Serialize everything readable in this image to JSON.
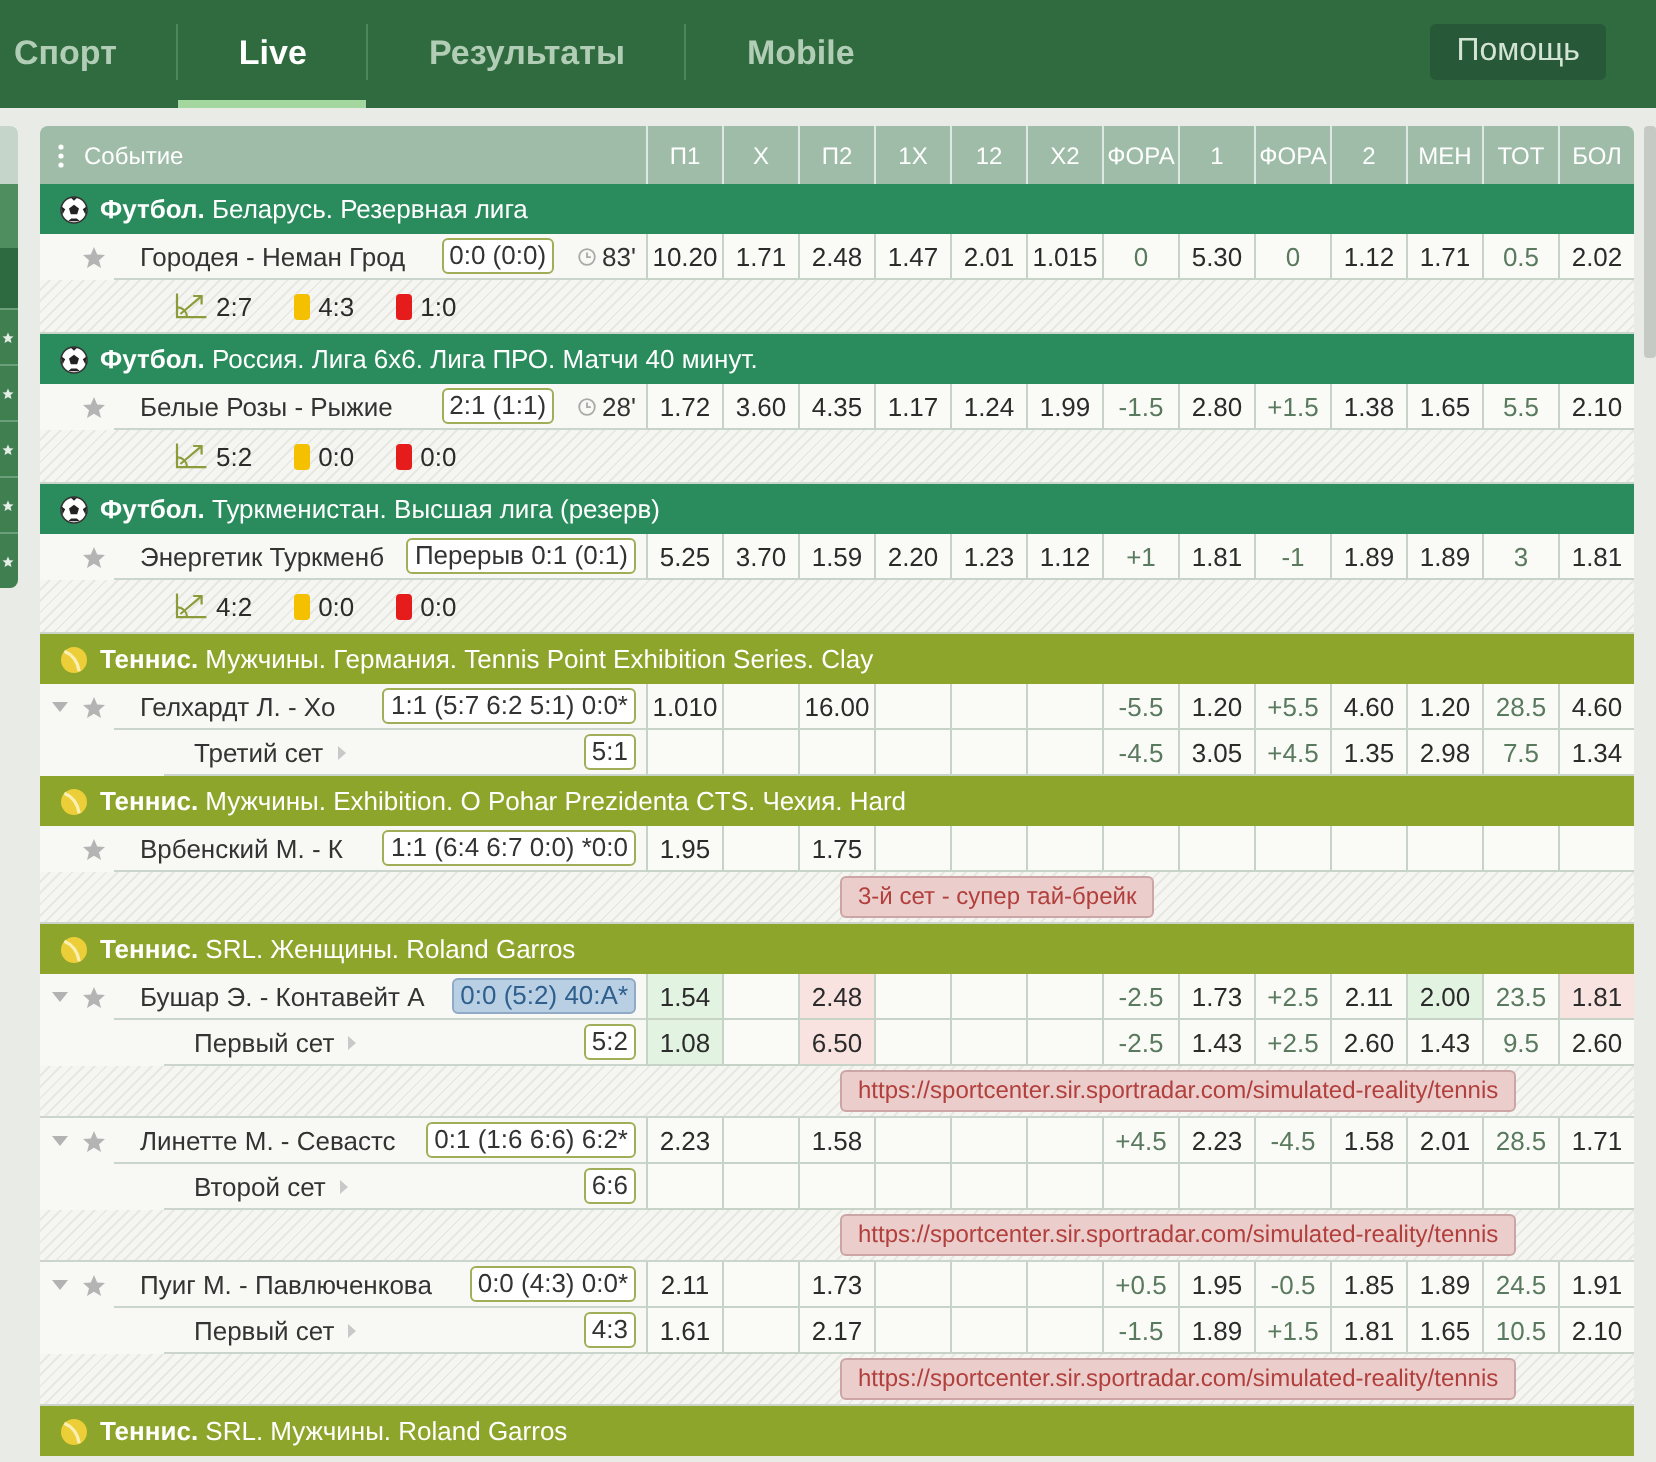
{
  "nav": {
    "tabs": [
      {
        "label": "Спорт",
        "selected": false
      },
      {
        "label": "Live",
        "selected": true
      },
      {
        "label": "Результаты",
        "selected": false
      },
      {
        "label": "Mobile",
        "selected": false
      }
    ],
    "help_button": "Помощь"
  },
  "table": {
    "event_header": "Событие",
    "columns": [
      {
        "label": "П1",
        "kind": "odds"
      },
      {
        "label": "X",
        "kind": "odds"
      },
      {
        "label": "П2",
        "kind": "odds"
      },
      {
        "label": "1X",
        "kind": "odds"
      },
      {
        "label": "12",
        "kind": "odds"
      },
      {
        "label": "X2",
        "kind": "odds"
      },
      {
        "label": "ФОРА",
        "kind": "line"
      },
      {
        "label": "1",
        "kind": "odds"
      },
      {
        "label": "ФОРА",
        "kind": "line"
      },
      {
        "label": "2",
        "kind": "odds"
      },
      {
        "label": "МЕН",
        "kind": "odds"
      },
      {
        "label": "ТОТ",
        "kind": "line"
      },
      {
        "label": "БОЛ",
        "kind": "odds"
      }
    ],
    "leagues": [
      {
        "kind": "football",
        "title": "**Футбол.** Беларусь. Резервная лига",
        "matches": [
          {
            "teams": "Городея - Неман Грод",
            "expandable": false,
            "favorite": false,
            "score": "0:0 (0:0)",
            "score_updated": false,
            "time": "83'",
            "odds": [
              {
                "kind": "plain",
                "value": "10.20"
              },
              {
                "kind": "plain",
                "value": "1.71"
              },
              {
                "kind": "plain",
                "value": "2.48"
              },
              {
                "kind": "plain",
                "value": "1.47"
              },
              {
                "kind": "plain",
                "value": "2.01"
              },
              {
                "kind": "plain",
                "value": "1.015"
              },
              {
                "kind": "plain",
                "value": "0"
              },
              {
                "kind": "plain",
                "value": "5.30"
              },
              {
                "kind": "plain",
                "value": "0"
              },
              {
                "kind": "plain",
                "value": "1.12"
              },
              {
                "kind": "plain",
                "value": "1.71"
              },
              {
                "kind": "plain",
                "value": "0.5"
              },
              {
                "kind": "plain",
                "value": "2.02"
              }
            ],
            "stats": [
              {
                "kind": "corners",
                "value": "2:7"
              },
              {
                "kind": "yellow_cards",
                "value": "4:3"
              },
              {
                "kind": "red_cards",
                "value": "1:0"
              }
            ]
          }
        ]
      },
      {
        "kind": "football",
        "title": "**Футбол.** Россия. Лига 6х6. Лига ПРО. Матчи 40 минут.",
        "matches": [
          {
            "teams": "Белые Розы - Рыжие",
            "expandable": false,
            "favorite": false,
            "score": "2:1 (1:1)",
            "score_updated": false,
            "time": "28'",
            "odds": [
              {
                "kind": "plain",
                "value": "1.72"
              },
              {
                "kind": "plain",
                "value": "3.60"
              },
              {
                "kind": "plain",
                "value": "4.35"
              },
              {
                "kind": "plain",
                "value": "1.17"
              },
              {
                "kind": "plain",
                "value": "1.24"
              },
              {
                "kind": "plain",
                "value": "1.99"
              },
              {
                "kind": "plain",
                "value": "-1.5"
              },
              {
                "kind": "plain",
                "value": "2.80"
              },
              {
                "kind": "plain",
                "value": "+1.5"
              },
              {
                "kind": "plain",
                "value": "1.38"
              },
              {
                "kind": "plain",
                "value": "1.65"
              },
              {
                "kind": "plain",
                "value": "5.5"
              },
              {
                "kind": "plain",
                "value": "2.10"
              }
            ],
            "stats": [
              {
                "kind": "corners",
                "value": "5:2"
              },
              {
                "kind": "yellow_cards",
                "value": "0:0"
              },
              {
                "kind": "red_cards",
                "value": "0:0"
              }
            ]
          }
        ]
      },
      {
        "kind": "football",
        "title": "**Футбол.** Туркменистан. Высшая лига (резерв)",
        "matches": [
          {
            "teams": "Энергетик Туркменб",
            "expandable": false,
            "favorite": false,
            "score": "Перерыв 0:1 (0:1)",
            "score_updated": false,
            "odds": [
              {
                "kind": "plain",
                "value": "5.25"
              },
              {
                "kind": "plain",
                "value": "3.70"
              },
              {
                "kind": "plain",
                "value": "1.59"
              },
              {
                "kind": "plain",
                "value": "2.20"
              },
              {
                "kind": "plain",
                "value": "1.23"
              },
              {
                "kind": "plain",
                "value": "1.12"
              },
              {
                "kind": "plain",
                "value": "+1"
              },
              {
                "kind": "plain",
                "value": "1.81"
              },
              {
                "kind": "plain",
                "value": "-1"
              },
              {
                "kind": "plain",
                "value": "1.89"
              },
              {
                "kind": "plain",
                "value": "1.89"
              },
              {
                "kind": "plain",
                "value": "3"
              },
              {
                "kind": "plain",
                "value": "1.81"
              }
            ],
            "stats": [
              {
                "kind": "corners",
                "value": "4:2"
              },
              {
                "kind": "yellow_cards",
                "value": "0:0"
              },
              {
                "kind": "red_cards",
                "value": "0:0"
              }
            ]
          }
        ]
      },
      {
        "kind": "tennis",
        "title": "**Теннис.** Мужчины. Германия. Tennis Point Exhibition Series. Clay",
        "matches": [
          {
            "teams": "Гелхардт Л. - Хо",
            "expandable": true,
            "favorite": false,
            "score": "1:1 (5:7 6:2 5:1) 0:0*",
            "score_updated": false,
            "odds": [
              {
                "kind": "plain",
                "value": "1.010"
              },
              {
                "kind": "empty"
              },
              {
                "kind": "plain",
                "value": "16.00"
              },
              {
                "kind": "empty"
              },
              {
                "kind": "empty"
              },
              {
                "kind": "empty"
              },
              {
                "kind": "plain",
                "value": "-5.5"
              },
              {
                "kind": "plain",
                "value": "1.20"
              },
              {
                "kind": "plain",
                "value": "+5.5"
              },
              {
                "kind": "plain",
                "value": "4.60"
              },
              {
                "kind": "plain",
                "value": "1.20"
              },
              {
                "kind": "plain",
                "value": "28.5"
              },
              {
                "kind": "plain",
                "value": "4.60"
              }
            ],
            "current_set": {
              "label": "Третий сет",
              "score": "5:1",
              "odds": [
                {
                  "kind": "empty"
                },
                {
                  "kind": "empty"
                },
                {
                  "kind": "empty"
                },
                {
                  "kind": "empty"
                },
                {
                  "kind": "empty"
                },
                {
                  "kind": "empty"
                },
                {
                  "kind": "plain",
                  "value": "-4.5"
                },
                {
                  "kind": "plain",
                  "value": "3.05"
                },
                {
                  "kind": "plain",
                  "value": "+4.5"
                },
                {
                  "kind": "plain",
                  "value": "1.35"
                },
                {
                  "kind": "plain",
                  "value": "2.98"
                },
                {
                  "kind": "plain",
                  "value": "7.5"
                },
                {
                  "kind": "plain",
                  "value": "1.34"
                }
              ]
            }
          }
        ]
      },
      {
        "kind": "tennis",
        "title": "**Теннис.** Мужчины. Exhibition. O Pohar Prezidenta CTS. Чехия. Hard",
        "matches": [
          {
            "teams": "Врбенский М. - К",
            "expandable": false,
            "favorite": false,
            "score": "1:1 (6:4 6:7 0:0) *0:0",
            "score_updated": false,
            "odds": [
              {
                "kind": "plain",
                "value": "1.95"
              },
              {
                "kind": "empty"
              },
              {
                "kind": "plain",
                "value": "1.75"
              },
              {
                "kind": "empty"
              },
              {
                "kind": "empty"
              },
              {
                "kind": "empty"
              },
              {
                "kind": "empty"
              },
              {
                "kind": "empty"
              },
              {
                "kind": "empty"
              },
              {
                "kind": "empty"
              },
              {
                "kind": "empty"
              },
              {
                "kind": "empty"
              },
              {
                "kind": "empty"
              }
            ],
            "notice": "3-й сет - супер тай-брейк"
          }
        ]
      },
      {
        "kind": "tennis",
        "title": "**Теннис.** SRL. Женщины. Roland Garros",
        "matches": [
          {
            "teams": "Бушар Э. - Контавейт А",
            "expandable": true,
            "favorite": false,
            "score": "0:0 (5:2) 40:A*",
            "score_updated": true,
            "odds": [
              {
                "kind": "rising",
                "value": "1.54"
              },
              {
                "kind": "empty"
              },
              {
                "kind": "falling",
                "value": "2.48"
              },
              {
                "kind": "empty"
              },
              {
                "kind": "empty"
              },
              {
                "kind": "empty"
              },
              {
                "kind": "plain",
                "value": "-2.5"
              },
              {
                "kind": "plain",
                "value": "1.73"
              },
              {
                "kind": "plain",
                "value": "+2.5"
              },
              {
                "kind": "plain",
                "value": "2.11"
              },
              {
                "kind": "rising",
                "value": "2.00"
              },
              {
                "kind": "plain",
                "value": "23.5"
              },
              {
                "kind": "falling",
                "value": "1.81"
              }
            ],
            "current_set": {
              "label": "Первый сет",
              "score": "5:2",
              "odds": [
                {
                  "kind": "rising",
                  "value": "1.08"
                },
                {
                  "kind": "empty"
                },
                {
                  "kind": "falling",
                  "value": "6.50"
                },
                {
                  "kind": "empty"
                },
                {
                  "kind": "empty"
                },
                {
                  "kind": "empty"
                },
                {
                  "kind": "plain",
                  "value": "-2.5"
                },
                {
                  "kind": "plain",
                  "value": "1.43"
                },
                {
                  "kind": "plain",
                  "value": "+2.5"
                },
                {
                  "kind": "plain",
                  "value": "2.60"
                },
                {
                  "kind": "plain",
                  "value": "1.43"
                },
                {
                  "kind": "plain",
                  "value": "9.5"
                },
                {
                  "kind": "plain",
                  "value": "2.60"
                }
              ]
            },
            "notice": "https://sportcenter.sir.sportradar.com/simulated-reality/tennis"
          },
          {
            "teams": "Линетте М. - Севастс",
            "expandable": true,
            "favorite": false,
            "score": "0:1 (1:6 6:6) 6:2*",
            "score_updated": false,
            "odds": [
              {
                "kind": "plain",
                "value": "2.23"
              },
              {
                "kind": "empty"
              },
              {
                "kind": "plain",
                "value": "1.58"
              },
              {
                "kind": "empty"
              },
              {
                "kind": "empty"
              },
              {
                "kind": "empty"
              },
              {
                "kind": "plain",
                "value": "+4.5"
              },
              {
                "kind": "plain",
                "value": "2.23"
              },
              {
                "kind": "plain",
                "value": "-4.5"
              },
              {
                "kind": "plain",
                "value": "1.58"
              },
              {
                "kind": "plain",
                "value": "2.01"
              },
              {
                "kind": "plain",
                "value": "28.5"
              },
              {
                "kind": "plain",
                "value": "1.71"
              }
            ],
            "current_set": {
              "label": "Второй сет",
              "score": "6:6",
              "odds": [
                {
                  "kind": "empty"
                },
                {
                  "kind": "empty"
                },
                {
                  "kind": "empty"
                },
                {
                  "kind": "empty"
                },
                {
                  "kind": "empty"
                },
                {
                  "kind": "empty"
                },
                {
                  "kind": "empty"
                },
                {
                  "kind": "empty"
                },
                {
                  "kind": "empty"
                },
                {
                  "kind": "empty"
                },
                {
                  "kind": "empty"
                },
                {
                  "kind": "empty"
                },
                {
                  "kind": "empty"
                }
              ]
            },
            "notice": "https://sportcenter.sir.sportradar.com/simulated-reality/tennis"
          },
          {
            "teams": "Пуиг М. - Павлюченкова",
            "expandable": true,
            "favorite": false,
            "score": "0:0 (4:3) 0:0*",
            "score_updated": false,
            "odds": [
              {
                "kind": "plain",
                "value": "2.11"
              },
              {
                "kind": "empty"
              },
              {
                "kind": "plain",
                "value": "1.73"
              },
              {
                "kind": "empty"
              },
              {
                "kind": "empty"
              },
              {
                "kind": "empty"
              },
              {
                "kind": "plain",
                "value": "+0.5"
              },
              {
                "kind": "plain",
                "value": "1.95"
              },
              {
                "kind": "plain",
                "value": "-0.5"
              },
              {
                "kind": "plain",
                "value": "1.85"
              },
              {
                "kind": "plain",
                "value": "1.89"
              },
              {
                "kind": "plain",
                "value": "24.5"
              },
              {
                "kind": "plain",
                "value": "1.91"
              }
            ],
            "current_set": {
              "label": "Первый сет",
              "score": "4:3",
              "odds": [
                {
                  "kind": "plain",
                  "value": "1.61"
                },
                {
                  "kind": "empty"
                },
                {
                  "kind": "plain",
                  "value": "2.17"
                },
                {
                  "kind": "empty"
                },
                {
                  "kind": "empty"
                },
                {
                  "kind": "empty"
                },
                {
                  "kind": "plain",
                  "value": "-1.5"
                },
                {
                  "kind": "plain",
                  "value": "1.89"
                },
                {
                  "kind": "plain",
                  "value": "+1.5"
                },
                {
                  "kind": "plain",
                  "value": "1.81"
                },
                {
                  "kind": "plain",
                  "value": "1.65"
                },
                {
                  "kind": "plain",
                  "value": "10.5"
                },
                {
                  "kind": "plain",
                  "value": "2.10"
                }
              ]
            },
            "notice": "https://sportcenter.sir.sportradar.com/simulated-reality/tennis"
          }
        ]
      },
      {
        "kind": "tennis",
        "title": "**Теннис.** SRL. Мужчины. Roland Garros"
      }
    ]
  }
}
